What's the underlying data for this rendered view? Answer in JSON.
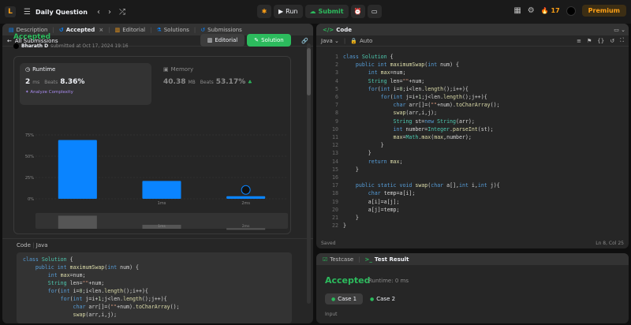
{
  "topbar": {
    "title": "Daily Question",
    "run_label": "Run",
    "submit_label": "Submit",
    "streak": "17",
    "premium_label": "Premium"
  },
  "left_tabs": [
    {
      "label": "Description"
    },
    {
      "label": "Accepted"
    },
    {
      "label": "Editorial"
    },
    {
      "label": "Solutions"
    },
    {
      "label": "Submissions"
    }
  ],
  "all_submissions_label": "All Submissions",
  "result": {
    "status": "Accepted",
    "author": "Bharath D",
    "submitted_text": "submitted at Oct 17, 2024 19:16",
    "editorial_label": "Editorial",
    "solution_label": "Solution"
  },
  "runtime": {
    "label": "Runtime",
    "value": "2",
    "unit": "ms",
    "beats_label": "Beats",
    "beats_value": "8.36%",
    "analyze_label": "Analyze Complexity"
  },
  "memory": {
    "label": "Memory",
    "value": "40.38",
    "unit": "MB",
    "beats_label": "Beats",
    "beats_value": "53.17%"
  },
  "chart_data": {
    "type": "bar",
    "y_ticks": [
      "75%",
      "50%",
      "25%",
      "0%"
    ],
    "ylim": [
      0,
      75
    ],
    "categories": [
      "",
      "1ms",
      "2ms"
    ],
    "values": [
      69,
      21,
      3
    ],
    "marker_category": "2ms",
    "bar_color": "#0a84ff"
  },
  "code_section": {
    "label": "Code",
    "language": "Java",
    "lines": [
      "class Solution {",
      "    public int maximumSwap(int num) {",
      "        int max=num;",
      "        String len=\"\"+num;",
      "        for(int i=0;i<len.length();i++){",
      "            for(int j=i+1;j<len.length();j++){",
      "                char arr[]=(\"\"+num).toCharArray();",
      "                swap(arr,i,j);"
    ]
  },
  "editor": {
    "tab_label": "Code",
    "language": "Java",
    "mode": "Auto",
    "line_numbers": [
      "1",
      "2",
      "3",
      "4",
      "5",
      "6",
      "7",
      "8",
      "9",
      "10",
      "11",
      "12",
      "13",
      "14",
      "15",
      "16",
      "17",
      "18",
      "19",
      "20",
      "21",
      "22"
    ],
    "lines": [
      "class Solution {",
      "    public int maximumSwap(int num) {",
      "        int max=num;",
      "        String len=\"\"+num;",
      "        for(int i=0;i<len.length();i++){",
      "            for(int j=i+1;j<len.length();j++){",
      "                char arr[]=(\"\"+num).toCharArray();",
      "                swap(arr,i,j);",
      "                String st=new String(arr);",
      "                int number=Integer.parseInt(st);",
      "                max=Math.max(max,number);",
      "            }",
      "        }",
      "        return max;",
      "    }",
      "",
      "    public static void swap(char a[],int i,int j){",
      "        char temp=a[i];",
      "        a[i]=a[j];",
      "        a[j]=temp;",
      "    }",
      "}"
    ],
    "status_left": "Saved",
    "status_right": "Ln 8, Col 25"
  },
  "test": {
    "tab_testcase": "Testcase",
    "tab_result": "Test Result",
    "status": "Accepted",
    "runtime_text": "Runtime: 0 ms",
    "case1": "Case 1",
    "case2": "Case 2",
    "input_label": "Input"
  },
  "colors": {
    "accent_green": "#2cbb5d",
    "accent_orange": "#ffa116",
    "bar_blue": "#0a84ff"
  }
}
